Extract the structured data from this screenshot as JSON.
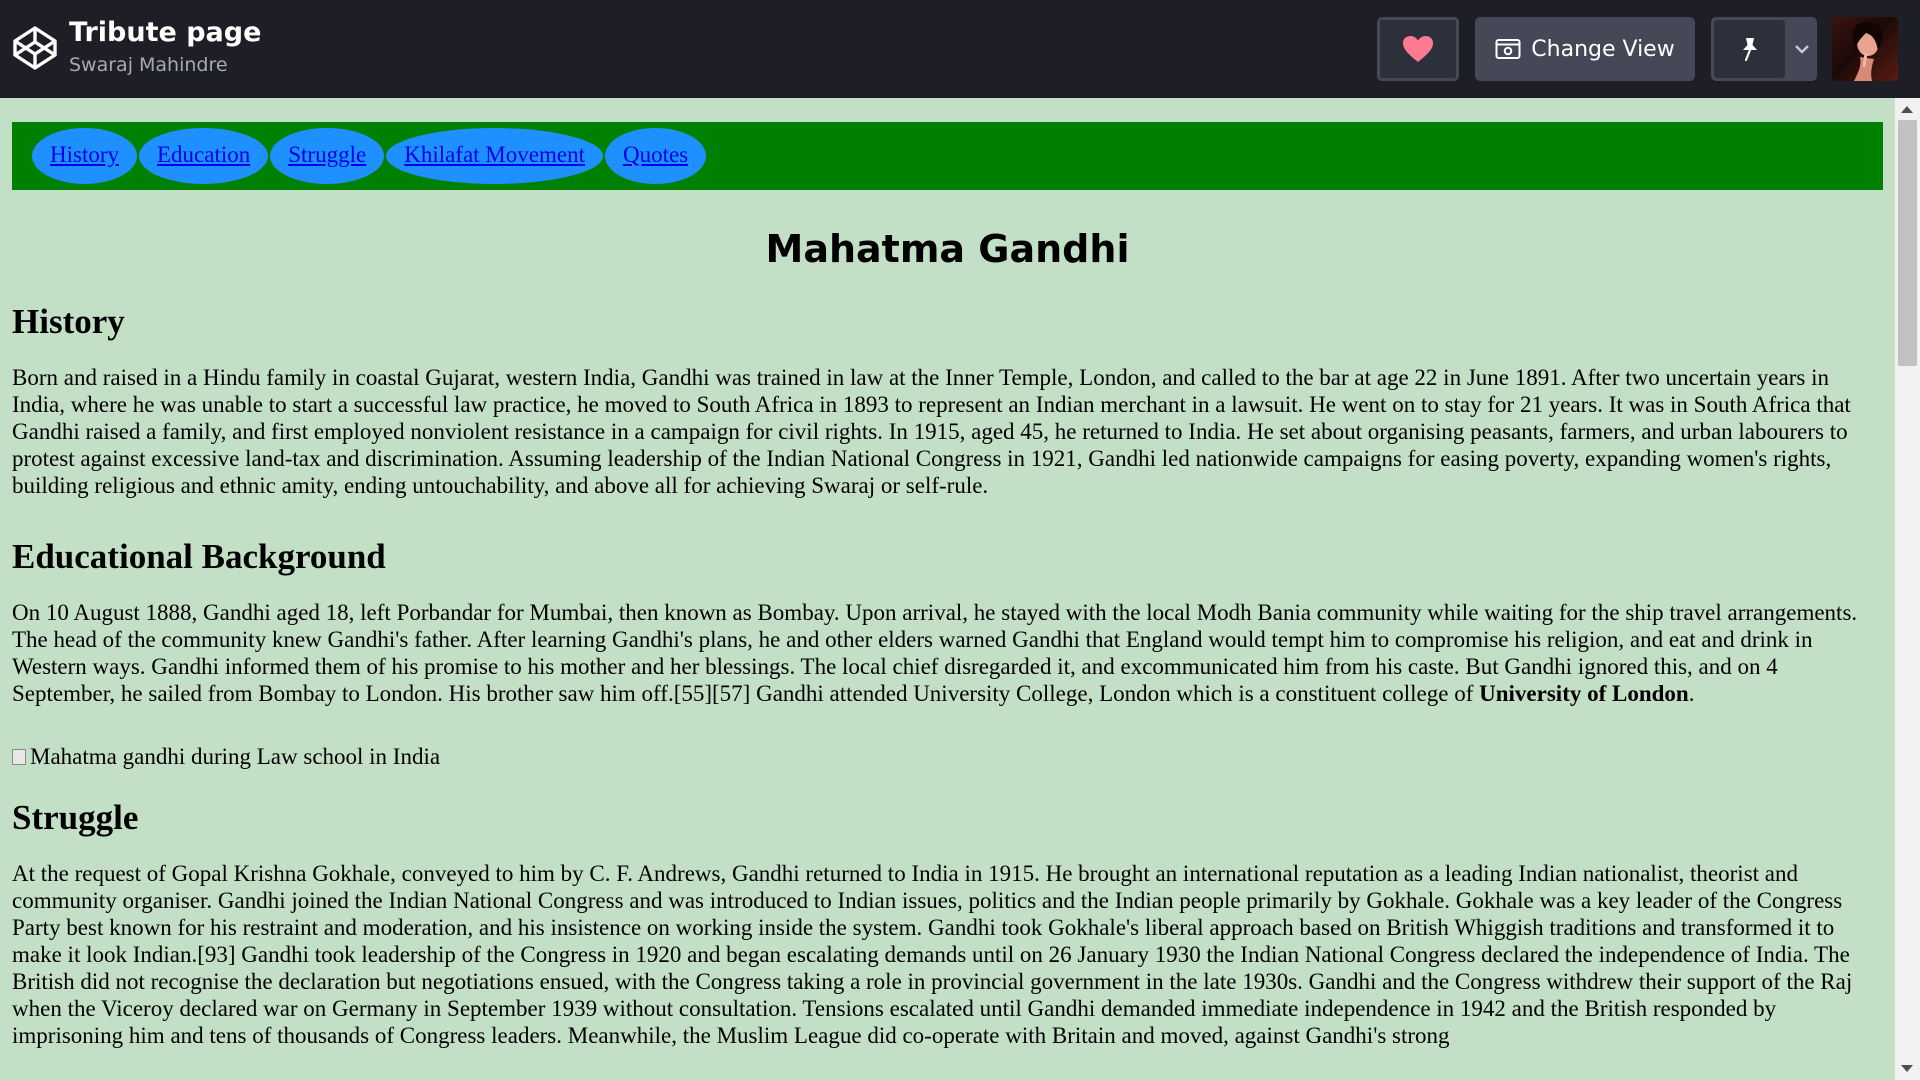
{
  "header": {
    "title": "Tribute page",
    "author": "Swaraj Mahindre",
    "logo_icon": "codepen-logo-icon",
    "view_label": "Change View",
    "heart_color": "#ff7991"
  },
  "nav": {
    "items": [
      {
        "label": "History"
      },
      {
        "label": "Education "
      },
      {
        "label": "Struggle"
      },
      {
        "label": "Khilafat Movement"
      },
      {
        "label": "Quotes"
      }
    ]
  },
  "page": {
    "main_title": "Mahatma Gandhi",
    "sections": {
      "history": {
        "heading": "History",
        "body": "Born and raised in a Hindu family in coastal Gujarat, western India, Gandhi was trained in law at the Inner Temple, London, and called to the bar at age 22 in June 1891. After two uncertain years in India, where he was unable to start a successful law practice, he moved to South Africa in 1893 to represent an Indian merchant in a lawsuit. He went on to stay for 21 years. It was in South Africa that Gandhi raised a family, and first employed nonviolent resistance in a campaign for civil rights. In 1915, aged 45, he returned to India. He set about organising peasants, farmers, and urban labourers to protest against excessive land-tax and discrimination. Assuming leadership of the Indian National Congress in 1921, Gandhi led nationwide campaigns for easing poverty, expanding women's rights, building religious and ethnic amity, ending untouchability, and above all for achieving Swaraj or self-rule."
      },
      "education": {
        "heading": "Educational Background",
        "body": "On 10 August 1888, Gandhi aged 18, left Porbandar for Mumbai, then known as Bombay. Upon arrival, he stayed with the local Modh Bania community while waiting for the ship travel arrangements. The head of the community knew Gandhi's father. After learning Gandhi's plans, he and other elders warned Gandhi that England would tempt him to compromise his religion, and eat and drink in Western ways. Gandhi informed them of his promise to his mother and her blessings. The local chief disregarded it, and excommunicated him from his caste. But Gandhi ignored this, and on 4 September, he sailed from Bombay to London. His brother saw him off.[55][57] Gandhi attended University College, London which is a constituent college of ",
        "bold_text": "University of London",
        "end": ".",
        "image_alt": "Mahatma gandhi during Law school in India"
      },
      "struggle": {
        "heading": "Struggle",
        "body": "At the request of Gopal Krishna Gokhale, conveyed to him by C. F. Andrews, Gandhi returned to India in 1915. He brought an international reputation as a leading Indian nationalist, theorist and community organiser. Gandhi joined the Indian National Congress and was introduced to Indian issues, politics and the Indian people primarily by Gokhale. Gokhale was a key leader of the Congress Party best known for his restraint and moderation, and his insistence on working inside the system. Gandhi took Gokhale's liberal approach based on British Whiggish traditions and transformed it to make it look Indian.[93] Gandhi took leadership of the Congress in 1920 and began escalating demands until on 26 January 1930 the Indian National Congress declared the independence of India. The British did not recognise the declaration but negotiations ensued, with the Congress taking a role in provincial government in the late 1930s. Gandhi and the Congress withdrew their support of the Raj when the Viceroy declared war on Germany in September 1939 without consultation. Tensions escalated until Gandhi demanded immediate independence in 1942 and the British responded by imprisoning him and tens of thousands of Congress leaders. Meanwhile, the Muslim League did co-operate with Britain and moved, against Gandhi's strong"
      }
    }
  },
  "colors": {
    "header_bg": "#1e1f26",
    "page_bg": "#c3e0c7",
    "nav_bg": "#008000",
    "pill_bg": "#1e90ff"
  }
}
